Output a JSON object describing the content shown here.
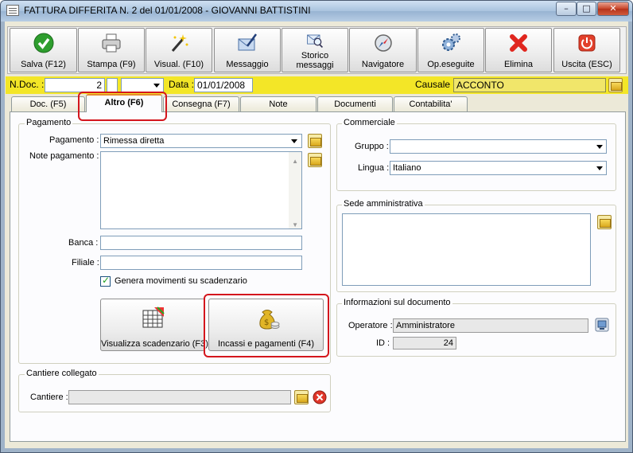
{
  "window": {
    "title": "FATTURA DIFFERITA N. 2  del 01/01/2008 - GIOVANNI BATTISTINI"
  },
  "toolbar": {
    "save": "Salva (F12)",
    "print": "Stampa (F9)",
    "view": "Visual. (F10)",
    "message": "Messaggio",
    "history_1": "Storico",
    "history_2": "messaggi",
    "navigator": "Navigatore",
    "operations": "Op.eseguite",
    "delete": "Elimina",
    "exit": "Uscita (ESC)"
  },
  "header": {
    "ndoc_label": "N.Doc. :",
    "ndoc_value": "2",
    "data_label": "Data :",
    "data_value": "01/01/2008",
    "causale_label": "Causale :",
    "causale_value": "ACCONTO"
  },
  "tabs": [
    "Doc. (F5)",
    "Altro (F6)",
    "Consegna (F7)",
    "Note",
    "Documenti",
    "Contabilita'"
  ],
  "pagamento": {
    "group_title": "Pagamento",
    "pagamento_label": "Pagamento :",
    "pagamento_value": "Rimessa diretta",
    "note_label": "Note pagamento :",
    "banca_label": "Banca :",
    "filiale_label": "Filiale :",
    "genera_label": "Genera movimenti su scadenzario",
    "visualizza_button": "Visualizza scadenzario (F3)",
    "incassi_button": "Incassi e pagamenti (F4)"
  },
  "commerciale": {
    "group_title": "Commerciale",
    "gruppo_label": "Gruppo :",
    "lingua_label": "Lingua :",
    "lingua_value": "Italiano"
  },
  "sede": {
    "group_title": "Sede amministrativa"
  },
  "info": {
    "group_title": "Informazioni sul documento",
    "operatore_label": "Operatore :",
    "operatore_value": "Amministratore",
    "id_label": "ID :",
    "id_value": "24"
  },
  "cantiere": {
    "group_title": "Cantiere collegato",
    "cantiere_label": "Cantiere :"
  },
  "colors": {
    "accent_yellow": "#f3e627",
    "highlight_red": "#d4161d"
  }
}
